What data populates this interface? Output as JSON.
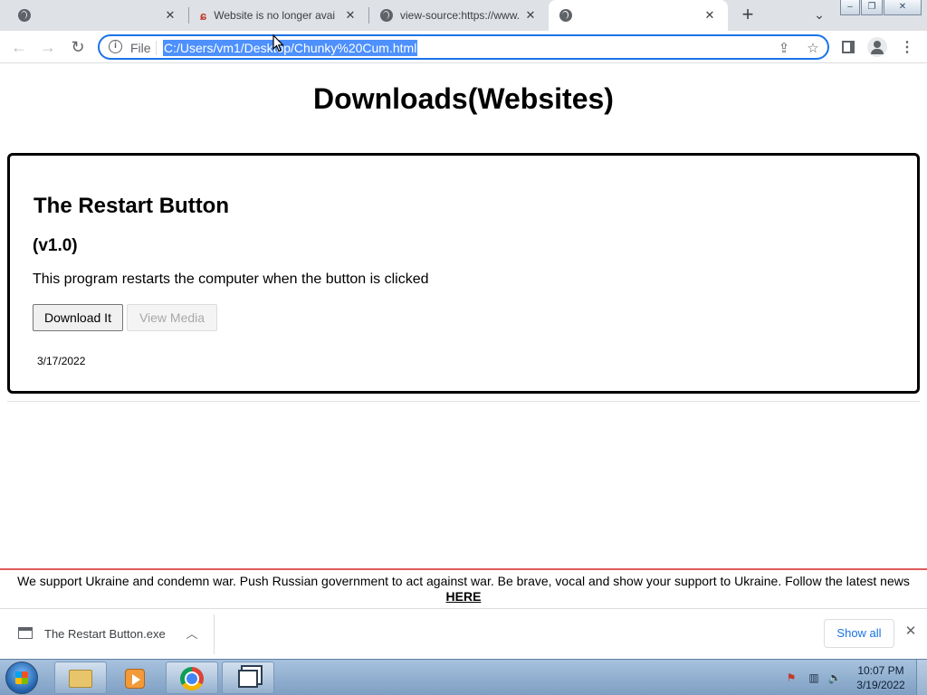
{
  "browser": {
    "tabs": [
      {
        "title": "",
        "active": false
      },
      {
        "title": "Website is no longer avai",
        "active": false
      },
      {
        "title": "view-source:https://www.",
        "active": false
      },
      {
        "title": "",
        "active": true
      }
    ],
    "address": {
      "scheme": "File",
      "url": "C:/Users/vm1/Desktop/Chunky%20Cum.html"
    }
  },
  "page": {
    "title": "Downloads(Websites)",
    "card": {
      "name": "The Restart Button",
      "version": "(v1.0)",
      "description": "This program restarts the computer when the button is clicked",
      "download_label": "Download It",
      "media_label": "View Media",
      "date": "3/17/2022"
    }
  },
  "banner": {
    "text": "We support Ukraine and condemn war. Push Russian government to act against war. Be brave, vocal and show your support to Ukraine. Follow the latest news",
    "link": "HERE"
  },
  "download_shelf": {
    "file_name": "The Restart Button.exe",
    "show_all": "Show all"
  },
  "taskbar": {
    "time": "10:07 PM",
    "date": "3/19/2022"
  }
}
